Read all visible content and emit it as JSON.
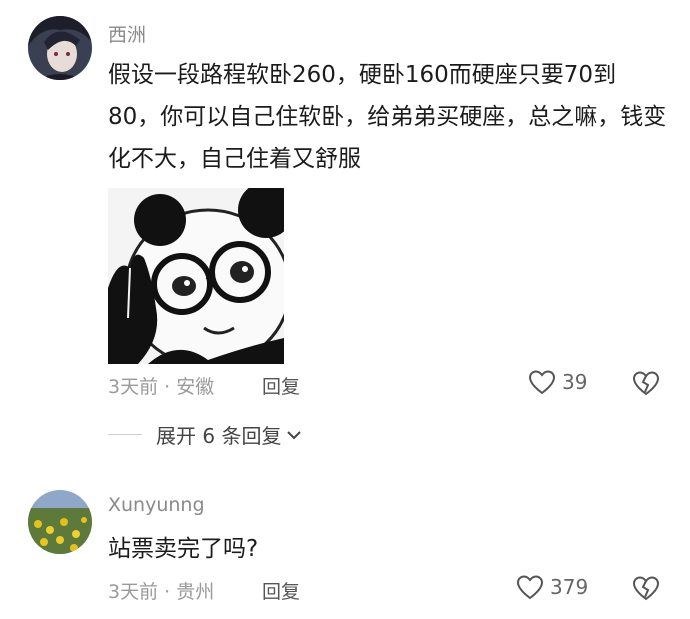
{
  "comments": [
    {
      "username": "西洲",
      "text": "假设一段路程软卧260，硬卧160而硬座只要70到80，你可以自己住软卧，给弟弟买硬座，总之嘛，钱变化不大，自己住着又舒服",
      "time_location": "3天前 · 安徽",
      "reply_label": "回复",
      "like_count": "39",
      "expand_replies_label": "展开 6 条回复"
    },
    {
      "username": "Xunyunng",
      "text": "站票卖完了吗?",
      "time_location": "3天前 · 贵州",
      "reply_label": "回复",
      "like_count": "379"
    }
  ]
}
